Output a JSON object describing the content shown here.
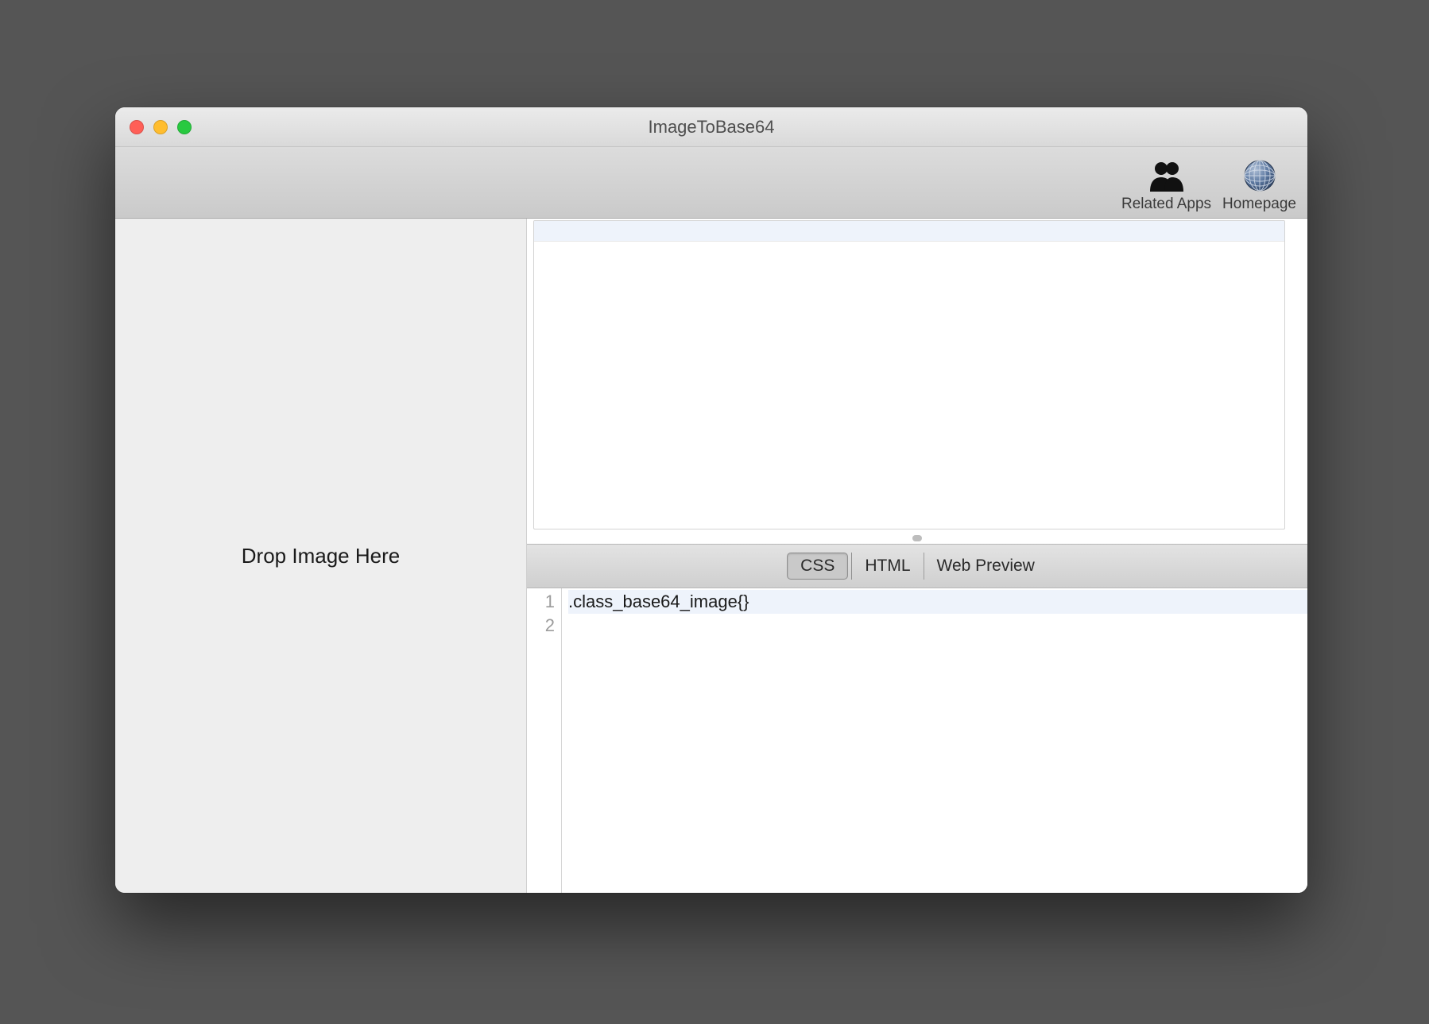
{
  "window": {
    "title": "ImageToBase64"
  },
  "toolbar": {
    "related_apps": {
      "label": "Related Apps"
    },
    "homepage": {
      "label": "Homepage"
    }
  },
  "sidebar": {
    "drop_label": "Drop Image Here"
  },
  "tabs": {
    "css": "CSS",
    "html": "HTML",
    "web_preview": "Web Preview",
    "active": "css"
  },
  "editor": {
    "gutter": [
      "1",
      "2"
    ],
    "lines": [
      ".class_base64_image{}",
      ""
    ]
  }
}
